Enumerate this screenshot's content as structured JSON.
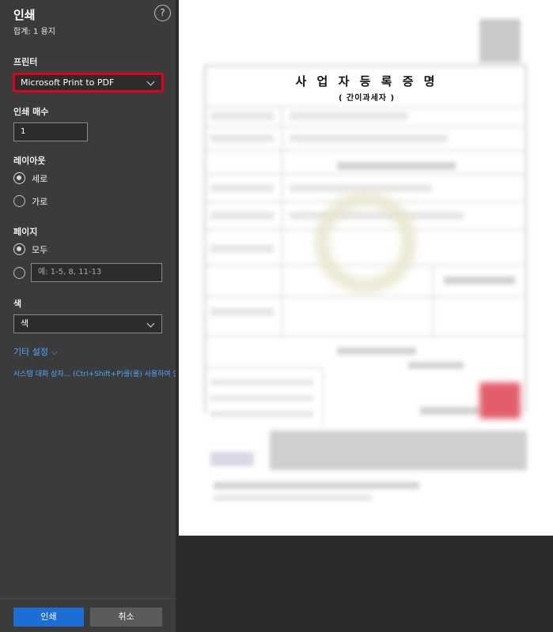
{
  "panel": {
    "title": "인쇄",
    "subtitle": "합계: 1 용지",
    "help_icon": "?",
    "printer": {
      "label": "프린터",
      "value": "Microsoft Print to PDF"
    },
    "copies": {
      "label": "인쇄 매수",
      "value": "1"
    },
    "layout": {
      "label": "레이아웃",
      "options": [
        "세로",
        "가로"
      ],
      "selected": "세로"
    },
    "pages": {
      "label": "페이지",
      "all": "모두",
      "placeholder": "예: 1-5, 8, 11-13",
      "selected": "모두"
    },
    "color": {
      "label": "색",
      "value": "색"
    },
    "more_settings": "기타 설정 ⌵",
    "system_dialog": "시스템 대화 상자... (Ctrl+Shift+P)를(를) 사용하여 인쇄",
    "buttons": {
      "print": "인쇄",
      "cancel": "취소"
    }
  },
  "preview": {
    "doc_title": "사 업 자 등 록 증 명",
    "doc_subtitle": "( 간이과세자 )"
  },
  "colors": {
    "panel_bg": "#3b3b3b",
    "accent": "#1b6ed6",
    "link": "#4ea8ff",
    "highlight": "#e2001a"
  }
}
